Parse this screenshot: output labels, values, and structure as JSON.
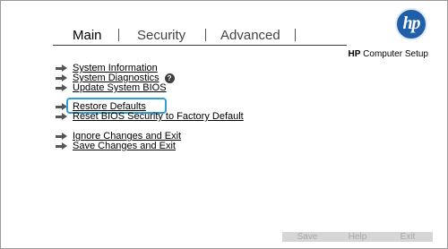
{
  "header": {
    "tabs": [
      {
        "label": "Main"
      },
      {
        "label": "Security"
      },
      {
        "label": "Advanced"
      }
    ],
    "brand_bold": "HP",
    "brand_rest": " Computer Setup",
    "logo_text": "hp"
  },
  "menu": {
    "items": [
      {
        "label": "System Information"
      },
      {
        "label": "System Diagnostics",
        "badge": "?"
      },
      {
        "label": "Update System BIOS"
      },
      {
        "label": "Restore Defaults"
      },
      {
        "label": "Reset BIOS Security to Factory Default"
      },
      {
        "label": "Ignore Changes and Exit"
      },
      {
        "label": "Save Changes and Exit"
      }
    ]
  },
  "footer": {
    "save_label": "Save",
    "help_label": "Help",
    "exit_label": "Exit"
  },
  "colors": {
    "accent_highlight": "#2f9ed2",
    "hp_blue": "#1f5fa8"
  }
}
